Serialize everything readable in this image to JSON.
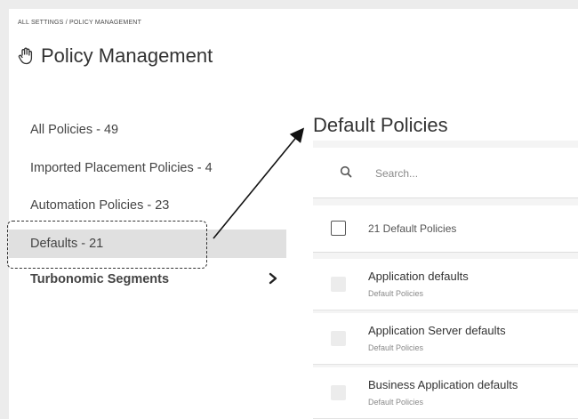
{
  "breadcrumb": "ALL SETTINGS / POLICY MANAGEMENT",
  "page_title": "Policy Management",
  "sidebar": {
    "items": [
      {
        "label": "All Policies - 49"
      },
      {
        "label": "Imported Placement Policies - 4"
      },
      {
        "label": "Automation Policies - 23"
      },
      {
        "label": "Defaults - 21"
      },
      {
        "label": "Turbonomic Segments"
      }
    ],
    "selected_index": 3
  },
  "main": {
    "title": "Default Policies",
    "search": {
      "placeholder": "Search...",
      "value": ""
    },
    "count_label": "21 Default Policies",
    "rows": [
      {
        "name": "Application defaults",
        "sub": "Default Policies"
      },
      {
        "name": "Application Server defaults",
        "sub": "Default Policies"
      },
      {
        "name": "Business Application defaults",
        "sub": "Default Policies"
      }
    ]
  },
  "icons": {
    "title": "hand-icon",
    "search": "search-icon",
    "chevron": "chevron-right-icon"
  }
}
